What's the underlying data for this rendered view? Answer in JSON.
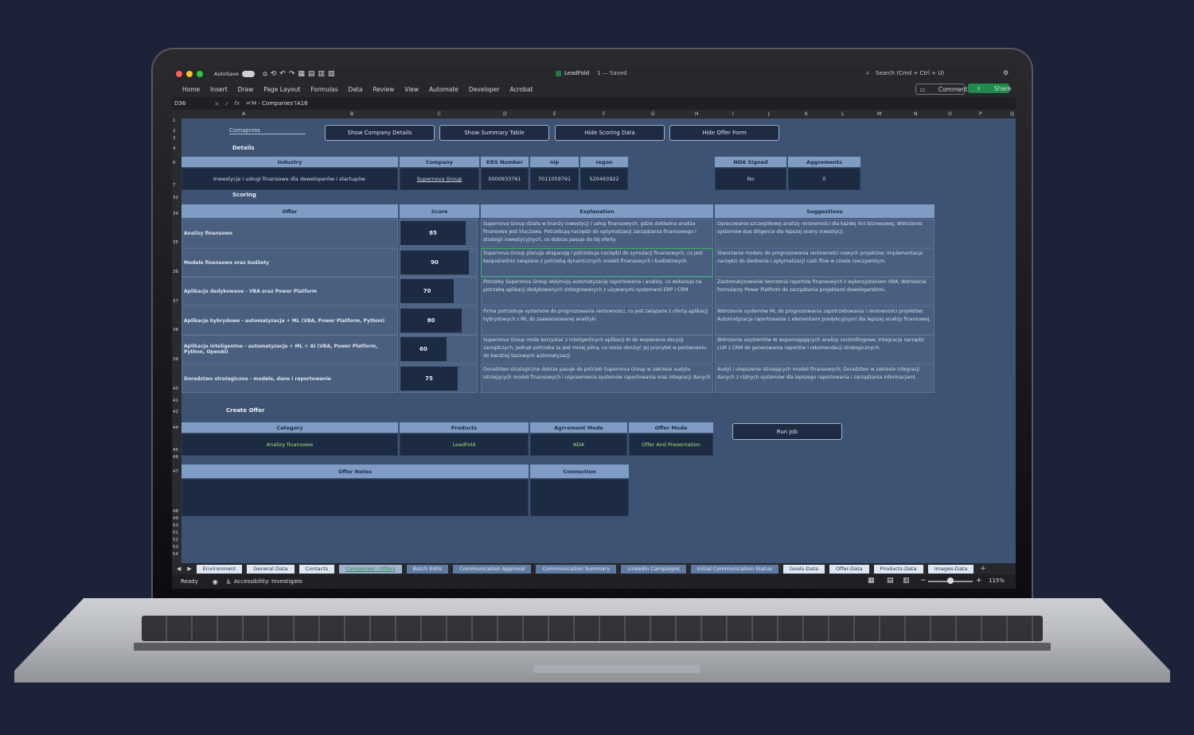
{
  "app": {
    "autosave_label": "AutoSave",
    "title": "LeadFold",
    "saved_status": "1 — Saved",
    "search_placeholder": "Search (Cmd + Ctrl + U)",
    "comments_label": "Comments",
    "share_label": "Share"
  },
  "ribbon": {
    "tabs": [
      "Home",
      "Insert",
      "Draw",
      "Page Layout",
      "Formulas",
      "Data",
      "Review",
      "View",
      "Automate",
      "Developer",
      "Acrobat"
    ]
  },
  "formula_bar": {
    "cell_ref": "D36",
    "formula": "='H - Companies'!A16"
  },
  "columns": [
    "A",
    "B",
    "C",
    "D",
    "E",
    "F",
    "G",
    "H",
    "I",
    "J",
    "K",
    "L",
    "M",
    "N",
    "O",
    "P",
    "Q"
  ],
  "rows": [
    "1",
    "2",
    "3",
    "4",
    "6",
    "7",
    "32",
    "34",
    "35",
    "36",
    "37",
    "38",
    "39",
    "40",
    "41",
    "42",
    "44",
    "45",
    "46",
    "47",
    "48",
    "49",
    "50",
    "51",
    "52",
    "53",
    "54"
  ],
  "sections": {
    "companies": "Comapnies",
    "details": "Details",
    "scoring": "Scoring",
    "create_offer": "Create Offer"
  },
  "buttons": {
    "show_company_details": "Show Company Details",
    "show_summary_table": "Show Summary Table",
    "hide_scoring_data": "Hide Scoring Data",
    "hide_offer_form": "Hide Offer Form",
    "run_job": "Run Job"
  },
  "details": {
    "headers": {
      "industry": "Industry",
      "company": "Company",
      "krs": "KRS Number",
      "nip": "nip",
      "regon": "regon",
      "nda": "NDA Signed",
      "agreements": "Aggrements"
    },
    "values": {
      "industry": "Inwestycje i usługi finansowe dla deweloperów i startupów.",
      "company": "Supernova Group",
      "krs": "0000933761",
      "nip": "7011059791",
      "regon": "520493922",
      "nda": "No",
      "agreements": "0"
    }
  },
  "scoring": {
    "headers": {
      "offer": "Offer",
      "score": "Score",
      "explanation": "Explanation",
      "suggestions": "Suggestions"
    },
    "rows": [
      {
        "offer": "Analizy finansowe",
        "score": 85,
        "score_fraction": 0.85,
        "explanation": "Supernova Group działa w branży inwestycji i usług finansowych, gdzie dokładna analiza finansowa jest kluczowa. Potrzebują narzędzi do optymalizacji zarządzania finansowego i strategii inwestycyjnych, co dobrze pasuje do tej oferty",
        "suggestions": "Opracowanie szczegółowej analizy rentowności dla każdej linii biznesowej; Wdrożenie systemów due diligence dla lepszej oceny inwestycji."
      },
      {
        "offer": "Modele finansowe oraz budżety",
        "score": 90,
        "score_fraction": 0.9,
        "explanation": "Supernova Group planuje ekspansję i potrzebuje narzędzi do symulacji finansowych, co jest bezpośrednio związane z potrzebą dynamicznych modeli finansowych i budżetowych",
        "suggestions": "Stworzenie modelu do prognozowania rentowności nowych projektów; Implementacja narzędzi do śledzenia i optymalizacji cash flow w czasie rzeczywistym."
      },
      {
        "offer": "Aplikacje dedykowane - VBA oraz Power Platform",
        "score": 70,
        "score_fraction": 0.7,
        "explanation": "Potrzeby Supernova Group obejmują automatyzację raportowania i analizy, co wskazuje na potrzebę aplikacji dedykowanych zintegrowanych z używanymi systemami ERP i CRM",
        "suggestions": "Zautomatyzowanie tworzenia raportów finansowych z wykorzystaniem VBA; Wdrożenie formularzy Power Platform do zarządzania projektami deweloperskimi."
      },
      {
        "offer": "Aplikacje hybrydowe - automatyzacja + ML (VBA, Power Platform, Python)",
        "score": 80,
        "score_fraction": 0.8,
        "explanation": "Firma potrzebuje systemów do prognozowania rentowności, co jest związane z ofertą aplikacji hybrydowych z ML do zaawansowanej analityki",
        "suggestions": "Wdrożenie systemów ML do prognozowania zapotrzebowania i rentowności projektów; Automatyzacja raportowania z elementami predykcyjnymi dla lepszej analizy finansowej."
      },
      {
        "offer": "Aplikacje inteligentne - automatyzacja + ML + AI (VBA, Power Platform, Python, OpenAI)",
        "score": 60,
        "score_fraction": 0.6,
        "explanation": "Supernova Group może korzystać z inteligentnych aplikacji AI do wspierania decyzji zarządczych, jednak potrzeba ta jest mniej pilna, co może obniżyć jej priorytet w porównaniu do bardziej bazowych automatyzacji",
        "suggestions": "Wdrożenie asystentów AI wspomagających analizy controllingowe; Integracja narzędzi LLM z CRM do generowania raportów i rekomendacji strategicznych."
      },
      {
        "offer": "Doradztwo strategiczne - modele, dane i raportowanie",
        "score": 75,
        "score_fraction": 0.75,
        "explanation": "Doradztwo strategiczne dobrze pasuje do potrzeb Supernova Group w zakresie audytu istniejących modeli finansowych i usprawnienia systemów raportowania oraz integracji danych",
        "suggestions": "Audyt i ulepszenie istniejących modeli finansowych; Doradztwo w zakresie integracji danych z różnych systemów dla lepszego raportowania i zarządzania informacjami."
      }
    ]
  },
  "create_offer": {
    "headers": {
      "category": "Category",
      "products": "Products",
      "agreement_mode": "Agrrement Mode",
      "offer_mode": "Offer Mode",
      "offer_notes": "Offer Notes",
      "connection": "Connection"
    },
    "values": {
      "category": "Analizy finansowe",
      "products": "LeadFold",
      "agreement_mode": "NDA",
      "offer_mode": "Offer And Presentation"
    }
  },
  "sheet_tabs": [
    "Environment",
    "General Data",
    "Contacts",
    "Companies - Offers",
    "Batch Edits",
    "Communication Approval",
    "Communication Summary",
    "Linkedin Campaigns",
    "Initial Communication Status",
    "Goals-Data",
    "Offer-Data",
    "Products-Data",
    "Images-Data"
  ],
  "status_bar": {
    "ready": "Ready",
    "accessibility": "Accessibility: Investigate",
    "zoom": "115%"
  },
  "colors": {
    "sheet_bg": "#3e5373",
    "header_blue": "#7f9cc4",
    "dark_cell": "#1c2a42",
    "accent_green": "#3cb371",
    "button_border": "#9fb3d0"
  }
}
